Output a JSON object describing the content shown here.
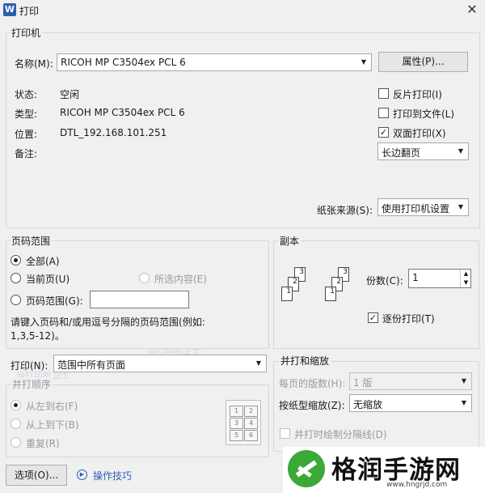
{
  "title": "打印",
  "printer": {
    "group_label": "打印机",
    "name_label": "名称(M):",
    "name_value": "RICOH MP C3504ex PCL 6",
    "properties_label": "属性(P)...",
    "status_label": "状态:",
    "status_value": "空闲",
    "type_label": "类型:",
    "type_value": "RICOH MP C3504ex PCL 6",
    "location_label": "位置:",
    "location_value": "DTL_192.168.101.251",
    "comment_label": "备注:",
    "reverse_label": "反片打印(I)",
    "to_file_label": "打印到文件(L)",
    "duplex_label": "双面打印(X)",
    "flip_value": "长边翻页",
    "paper_source_label": "纸张来源(S):",
    "paper_source_value": "使用打印机设置"
  },
  "range": {
    "group_label": "页码范围",
    "all_label": "全部(A)",
    "current_label": "当前页(U)",
    "selection_label": "所选内容(E)",
    "pages_label": "页码范围(G):",
    "hint": "请键入页码和/或用逗号分隔的页码范围(例如:",
    "hint2": "1,3,5-12)。"
  },
  "copies": {
    "group_label": "副本",
    "count_label": "份数(C):",
    "count_value": "1",
    "collate_label": "逐份打印(T)",
    "page_numbers": [
      "1",
      "2",
      "3",
      "1",
      "2",
      "3"
    ]
  },
  "print_what": {
    "label": "打印(N):",
    "value": "范围中所有页面"
  },
  "order": {
    "group_label": "并打顺序",
    "ltr_label": "从左到右(F)",
    "ttb_label": "从上到下(B)",
    "repeat_label": "重复(R)",
    "grid": [
      "1",
      "2",
      "3",
      "4",
      "5",
      "6"
    ]
  },
  "zoom": {
    "group_label": "并打和缩放",
    "per_page_label": "每页的版数(H):",
    "per_page_value": "1 版",
    "scale_label": "按纸型缩放(Z):",
    "scale_value": "无缩放",
    "draw_lines_label": "并打时绘制分隔线(D)"
  },
  "footer": {
    "options_label": "选项(O)...",
    "tips_label": "操作技巧"
  },
  "watermark": "@打印机卫士",
  "brand": {
    "name": "格润手游网",
    "url": "www.hngrjd.com"
  },
  "colors": {
    "accent": "#2b5fb4",
    "brand_green": "#3aa935"
  }
}
